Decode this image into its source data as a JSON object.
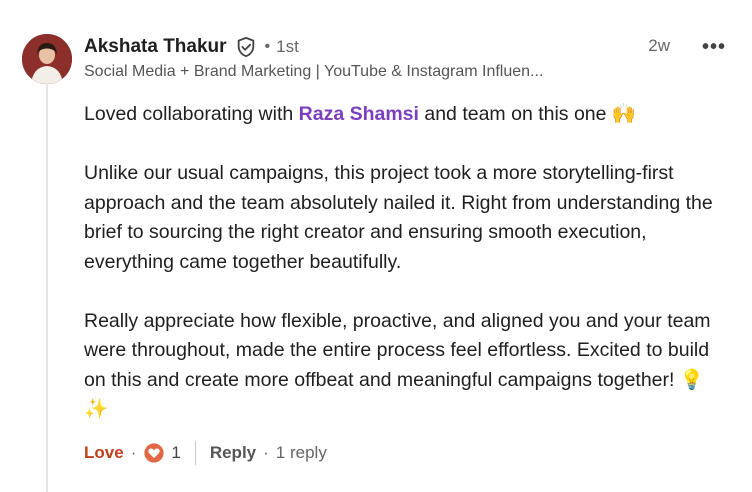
{
  "author": {
    "name": "Akshata Thakur",
    "connection": "1st",
    "headline": "Social Media + Brand Marketing | YouTube & Instagram Influen...",
    "timestamp": "2w"
  },
  "comment": {
    "line1_prefix": "Loved collaborating with ",
    "mention": "Raza Shamsi",
    "line1_suffix": " and team on this one 🙌",
    "paragraph2": "Unlike our usual campaigns, this project took a more storytelling-first approach and the team absolutely nailed it. Right from understanding the brief to sourcing the right creator and ensuring smooth execution, everything came together beautifully.",
    "paragraph3": "Really appreciate how flexible, proactive, and aligned you and your team were throughout, made the entire process feel effortless. Excited to build on this and create more offbeat and meaningful campaigns together! 💡✨"
  },
  "actions": {
    "love_label": "Love",
    "reaction_count": "1",
    "reply_label": "Reply",
    "reply_count": "1 reply"
  },
  "icons": {
    "verified": "verified-shield-icon",
    "more": "more-options-icon",
    "reaction": "heart-reaction-icon"
  },
  "colors": {
    "mention": "#7c3fbf",
    "love": "#c0411d",
    "reaction_badge": "#e16745"
  }
}
